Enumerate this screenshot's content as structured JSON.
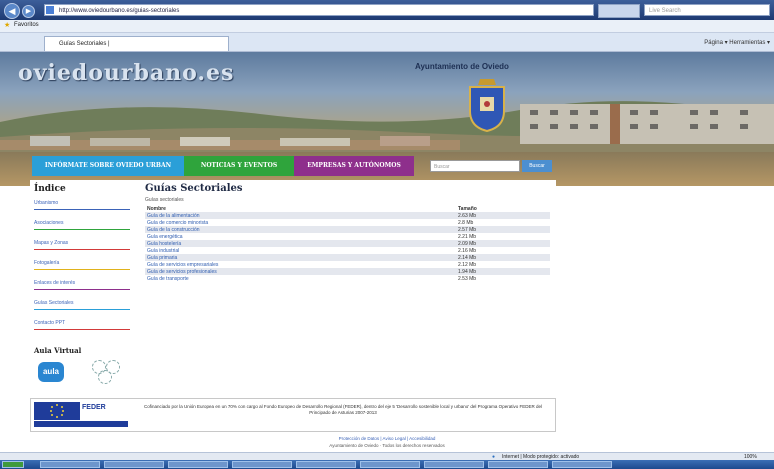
{
  "browser": {
    "url": "http://www.oviedourbano.es/guias-sectoriales",
    "search_placeholder": "Live Search",
    "fav_label": "Favoritos",
    "tab_title": "Guías Sectoriales |",
    "toolbar_items": "Página ▾  Herramientas ▾",
    "status_text": "Internet | Modo protegido: activado",
    "zoom": "100%"
  },
  "site": {
    "logo": "oviedourbano.es",
    "city_council": "Ayuntamiento de Oviedo",
    "menu": [
      {
        "label": "INFÓRMATE SOBRE OVIEDO URBAN",
        "color": "#2a9fd8"
      },
      {
        "label": "NOTICIAS Y EVENTOS",
        "color": "#2fa43c"
      },
      {
        "label": "EMPRESAS Y AUTÓNOMOS",
        "color": "#8e2f8c"
      }
    ],
    "search_placeholder": "Buscar",
    "search_button": "Buscar"
  },
  "sidebar": {
    "title": "Índice",
    "items": [
      {
        "label": "Urbanismo",
        "line": "#3b63b8"
      },
      {
        "label": "Asociaciones",
        "line": "#2fa43c"
      },
      {
        "label": "Mapas y Zonas",
        "line": "#d23a3a"
      },
      {
        "label": "Fotogalería",
        "line": "#e0b21c"
      },
      {
        "label": "Enlaces de interés",
        "line": "#8e2f8c"
      },
      {
        "label": "Guías Sectoriales",
        "line": "#2a9fd8"
      },
      {
        "label": "Contacto PPT",
        "line": "#d23a3a"
      }
    ],
    "aula_title": "Aula Virtual",
    "aula_logo": "aula"
  },
  "main": {
    "title": "Guías Sectoriales",
    "subtitle": "Guías sectoriales",
    "columns": [
      "Nombre",
      "Tamaño"
    ],
    "rows": [
      {
        "name": "Guía de la alimentación",
        "size": "2.63 Mb"
      },
      {
        "name": "Guía de comercio minorista",
        "size": "2.8 Mb"
      },
      {
        "name": "Guía de la construcción",
        "size": "2.57 Mb"
      },
      {
        "name": "Guía energética",
        "size": "2.21 Mb"
      },
      {
        "name": "Guía hostelería",
        "size": "2.09 Mb"
      },
      {
        "name": "Guía industrial",
        "size": "2.16 Mb"
      },
      {
        "name": "Guía primaria",
        "size": "2.14 Mb"
      },
      {
        "name": "Guía de servicios empresariales",
        "size": "2.12 Mb"
      },
      {
        "name": "Guía de servicios profesionales",
        "size": "1.94 Mb"
      },
      {
        "name": "Guía de transporte",
        "size": "2.53 Mb"
      }
    ]
  },
  "footer": {
    "feder": "FEDER",
    "feder_desc": "Cofinanciado por la Unión Europea en un 70% con cargo al Fondo Europeo de Desarrollo Regional (FEDER), dentro del eje 5 'Desarrollo sostenible local y urbano' del Programa Operativo FEDER del Principado de Asturias 2007-2013",
    "links": "Protección de Datos | Aviso Legal | Accesibilidad",
    "copyright": "Ayuntamiento de Oviedo · Todos los derechos reservados"
  }
}
